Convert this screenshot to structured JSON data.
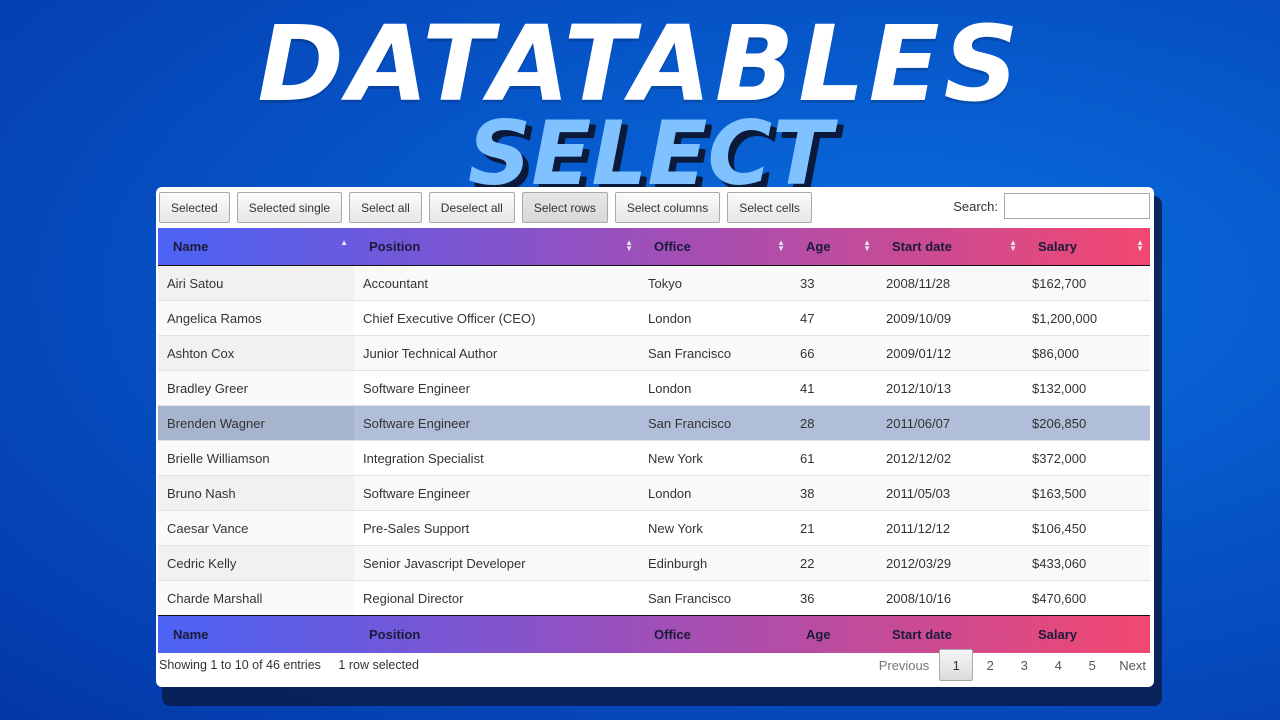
{
  "banner": {
    "title": "DATATABLES",
    "subtitle": "SELECT"
  },
  "toolbar": {
    "buttons": [
      "Selected",
      "Selected single",
      "Select all",
      "Deselect all",
      "Select rows",
      "Select columns",
      "Select cells"
    ],
    "active_button": "Select rows"
  },
  "search": {
    "label": "Search:",
    "value": ""
  },
  "table": {
    "columns": [
      "Name",
      "Position",
      "Office",
      "Age",
      "Start date",
      "Salary"
    ],
    "rows": [
      [
        "Airi Satou",
        "Accountant",
        "Tokyo",
        "33",
        "2008/11/28",
        "$162,700"
      ],
      [
        "Angelica Ramos",
        "Chief Executive Officer (CEO)",
        "London",
        "47",
        "2009/10/09",
        "$1,200,000"
      ],
      [
        "Ashton Cox",
        "Junior Technical Author",
        "San Francisco",
        "66",
        "2009/01/12",
        "$86,000"
      ],
      [
        "Bradley Greer",
        "Software Engineer",
        "London",
        "41",
        "2012/10/13",
        "$132,000"
      ],
      [
        "Brenden Wagner",
        "Software Engineer",
        "San Francisco",
        "28",
        "2011/06/07",
        "$206,850"
      ],
      [
        "Brielle Williamson",
        "Integration Specialist",
        "New York",
        "61",
        "2012/12/02",
        "$372,000"
      ],
      [
        "Bruno Nash",
        "Software Engineer",
        "London",
        "38",
        "2011/05/03",
        "$163,500"
      ],
      [
        "Caesar Vance",
        "Pre-Sales Support",
        "New York",
        "21",
        "2011/12/12",
        "$106,450"
      ],
      [
        "Cedric Kelly",
        "Senior Javascript Developer",
        "Edinburgh",
        "22",
        "2012/03/29",
        "$433,060"
      ],
      [
        "Charde Marshall",
        "Regional Director",
        "San Francisco",
        "36",
        "2008/10/16",
        "$470,600"
      ]
    ],
    "selected_row_index": 4,
    "sorted_column": "Name",
    "sort_direction": "ascending"
  },
  "info": {
    "entries": "Showing 1 to 10 of 46 entries",
    "selection": "1 row selected"
  },
  "pagination": {
    "previous": "Previous",
    "pages": [
      "1",
      "2",
      "3",
      "4",
      "5"
    ],
    "current": "1",
    "next": "Next"
  },
  "colors": {
    "header_start": "#4c63f5",
    "header_end": "#f24870",
    "selected_row": "#b0bed9",
    "background": "#0655c8"
  }
}
